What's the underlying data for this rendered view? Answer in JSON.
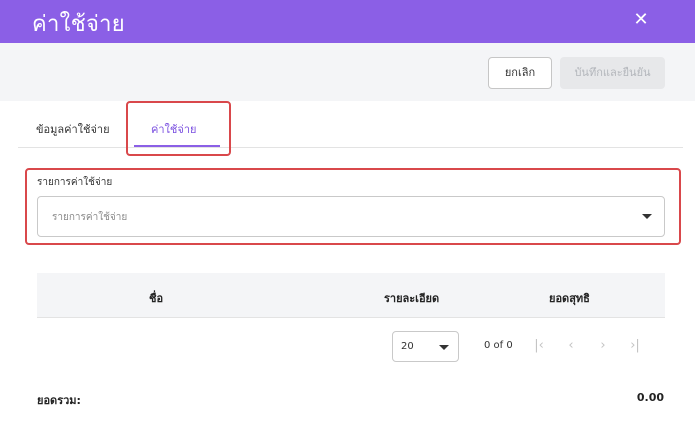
{
  "header": {
    "title": "ค่าใช้จ่าย",
    "close_icon": "close-icon"
  },
  "actions": {
    "cancel_label": "ยกเลิก",
    "save_label": "บันทึกและยืนยัน"
  },
  "tabs": [
    {
      "label": "ข้อมูลค่าใช้จ่าย",
      "active": false
    },
    {
      "label": "ค่าใช้จ่าย",
      "active": true
    }
  ],
  "expense_field": {
    "label": "รายการค่าใช้จ่าย",
    "placeholder": "รายการค่าใช้จ่าย"
  },
  "table": {
    "columns": [
      "ชื่อ",
      "รายละเอียด",
      "ยอดสุทธิ"
    ],
    "rows": []
  },
  "pagination": {
    "page_size": "20",
    "count_text": "0 of 0"
  },
  "summary": {
    "total_label": "ยอดรวม:",
    "total_value": "0.00"
  },
  "colors": {
    "accent": "#8b5fe6",
    "highlight": "#d9484b"
  }
}
